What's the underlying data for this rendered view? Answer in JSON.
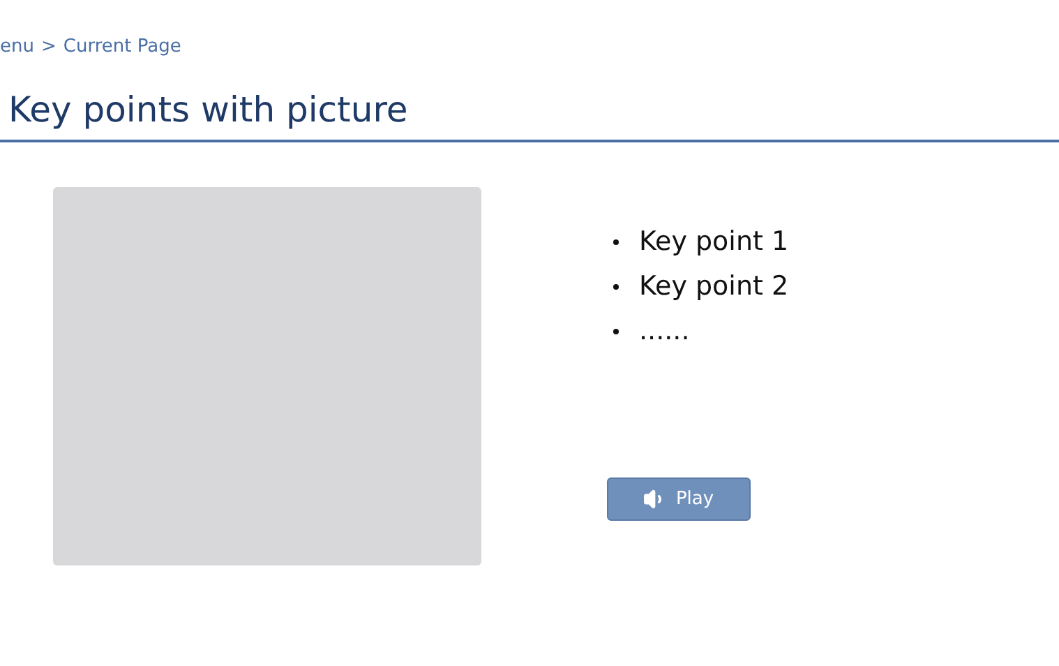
{
  "breadcrumb": {
    "items": [
      "enu",
      "Current Page"
    ],
    "separator": ">"
  },
  "title": "Key points with picture",
  "image": {
    "kind": "placeholder"
  },
  "key_points": [
    "Key point 1",
    "Key point 2",
    "......"
  ],
  "play_button": {
    "label": "Play"
  }
}
